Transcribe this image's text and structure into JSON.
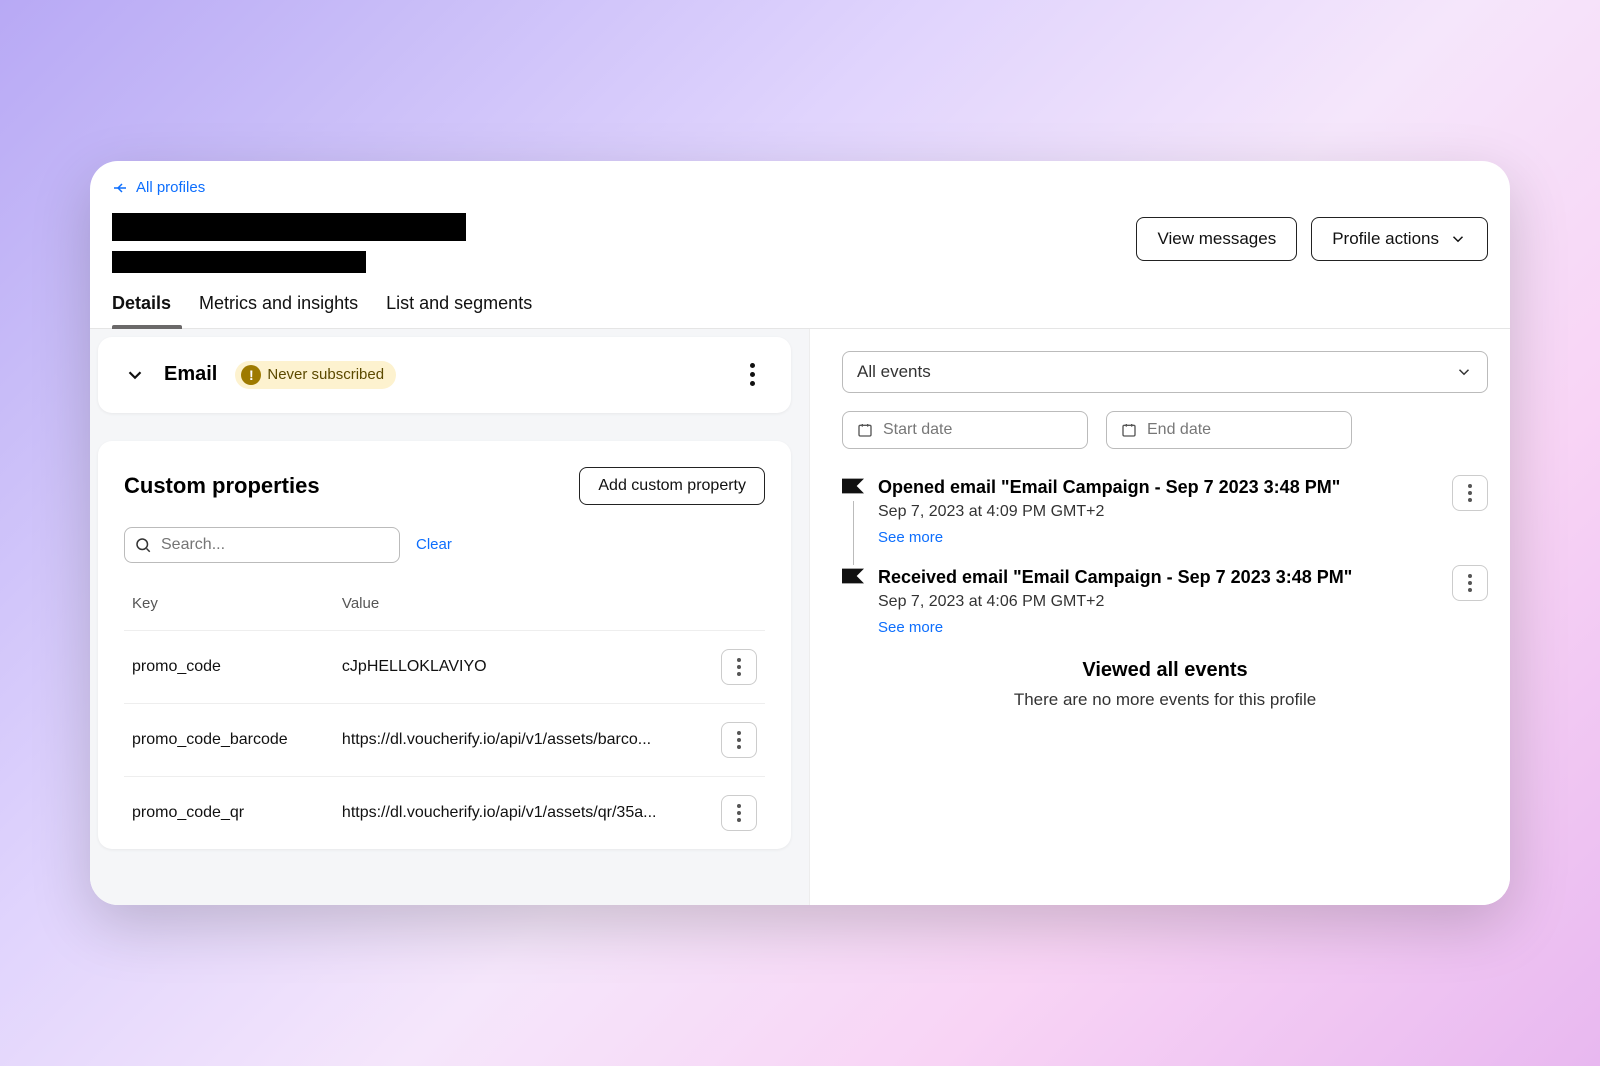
{
  "nav": {
    "back_label": "All profiles"
  },
  "header": {
    "view_messages": "View messages",
    "profile_actions": "Profile actions"
  },
  "tabs": {
    "details": "Details",
    "metrics": "Metrics and insights",
    "lists": "List and segments"
  },
  "email_card": {
    "title": "Email",
    "badge": "Never subscribed"
  },
  "custom_props": {
    "title": "Custom properties",
    "add_button": "Add custom property",
    "search_placeholder": "Search...",
    "clear": "Clear",
    "col_key": "Key",
    "col_value": "Value",
    "rows": [
      {
        "key": "promo_code",
        "value": "cJpHELLOKLAVIYO"
      },
      {
        "key": "promo_code_barcode",
        "value": "https://dl.voucherify.io/api/v1/assets/barco..."
      },
      {
        "key": "promo_code_qr",
        "value": "https://dl.voucherify.io/api/v1/assets/qr/35a..."
      }
    ]
  },
  "events_filter": {
    "all_label": "All events",
    "start_placeholder": "Start date",
    "end_placeholder": "End date"
  },
  "events": [
    {
      "title": "Opened email \"Email Campaign - Sep 7 2023 3:48 PM\"",
      "time": "Sep 7, 2023 at 4:09 PM GMT+2",
      "more": "See more"
    },
    {
      "title": "Received email \"Email Campaign - Sep 7 2023 3:48 PM\"",
      "time": "Sep 7, 2023 at 4:06 PM GMT+2",
      "more": "See more"
    }
  ],
  "events_end": {
    "title": "Viewed all events",
    "subtitle": "There are no more events for this profile"
  }
}
